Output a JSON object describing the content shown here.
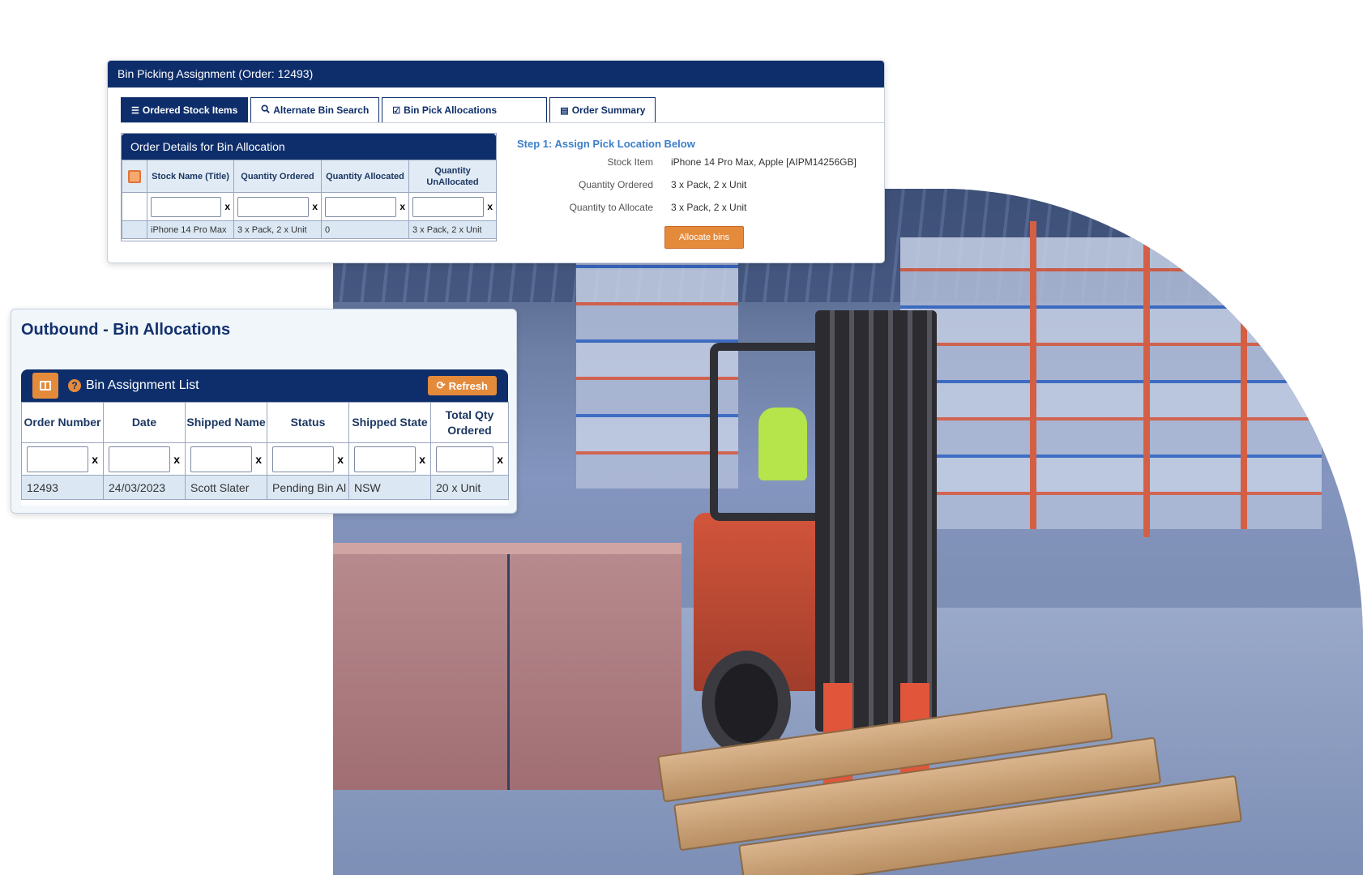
{
  "bin_picking": {
    "title": "Bin Picking Assignment (Order: 12493)",
    "tabs": [
      {
        "icon": "list-icon",
        "label": "Ordered Stock Items"
      },
      {
        "icon": "search-icon",
        "label": "Alternate Bin Search"
      },
      {
        "icon": "checkbox-icon",
        "label": "Bin Pick Allocations"
      },
      {
        "icon": "calendar-icon",
        "label": "Order Summary"
      }
    ],
    "order_details": {
      "title": "Order Details for Bin Allocation",
      "columns": [
        "Stock Name (Title)",
        "Quantity Ordered",
        "Quantity Allocated",
        "Quantity UnAllocated"
      ],
      "filter_clear": "x",
      "row": [
        "iPhone 14 Pro Max",
        "3 x Pack, 2 x Unit",
        "0",
        "3 x Pack, 2 x Unit"
      ]
    },
    "step": {
      "title": "Step 1: Assign Pick Location Below",
      "stock_item_label": "Stock Item",
      "stock_item_value": "iPhone 14 Pro Max, Apple [AIPM14256GB]",
      "qty_ordered_label": "Quantity Ordered",
      "qty_ordered_value": "3 x Pack, 2 x Unit",
      "qty_allocate_label": "Quantity to Allocate",
      "qty_allocate_value": "3 x Pack, 2 x Unit",
      "allocate_button": "Allocate bins"
    }
  },
  "outbound": {
    "title": "Outbound - Bin Allocations",
    "list_title": "Bin Assignment List",
    "refresh_label": "Refresh",
    "columns": [
      "Order Number",
      "Date",
      "Shipped Name",
      "Status",
      "Shipped State",
      "Total Qty Ordered"
    ],
    "filter_clear": "x",
    "row": [
      "12493",
      "24/03/2023",
      "Scott Slater",
      "Pending Bin Al",
      "NSW",
      "20 x Unit"
    ]
  },
  "colors": {
    "navy": "#0e2e6b",
    "accent_orange": "#e48a3b",
    "row_highlight": "#dbe8f4",
    "step_blue": "#3c7fc9"
  }
}
